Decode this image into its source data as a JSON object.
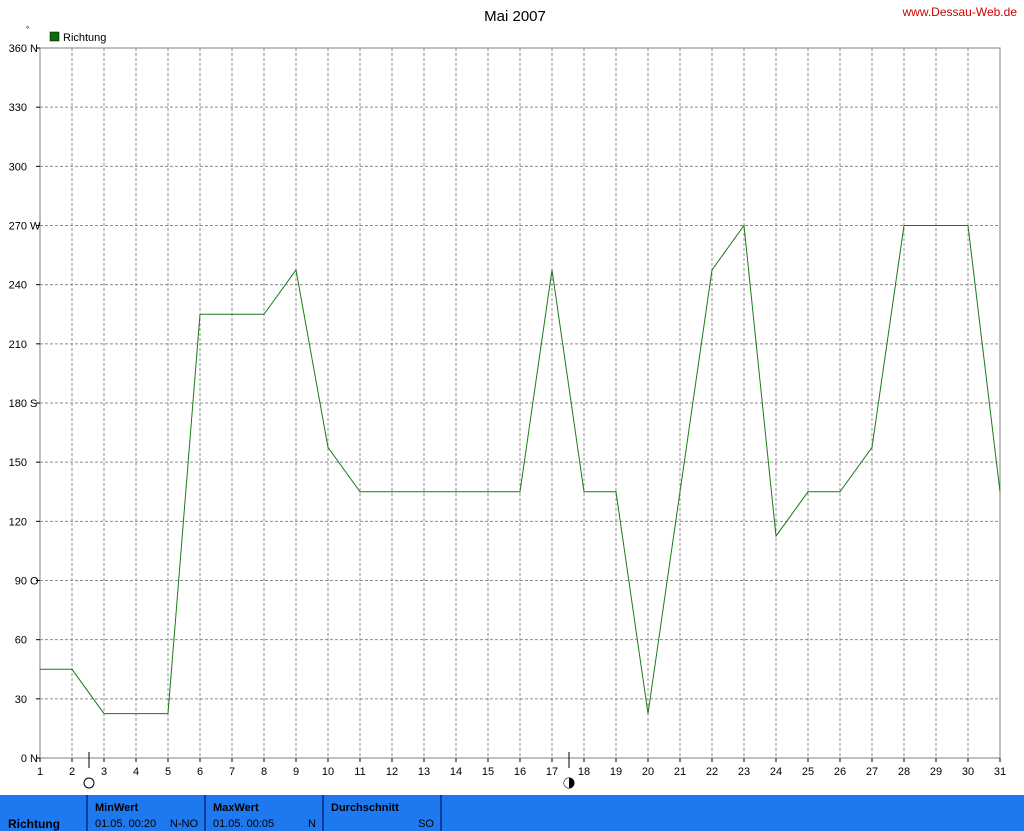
{
  "header": {
    "title": "Mai 2007",
    "url": "www.Dessau-Web.de",
    "unit_mark": "°"
  },
  "colors": {
    "line": "#1a7a1a",
    "legend_swatch": "#0a6e0a",
    "stats_bg": "#1e78f0",
    "grid": "#8c8c8c"
  },
  "icons": {
    "moon_full": "full-moon-icon",
    "moon_new": "new-moon-icon"
  },
  "moon_phases": [
    {
      "day": 2,
      "type": "full-moon"
    },
    {
      "day": 17,
      "type": "new-moon"
    }
  ],
  "chart_data": {
    "type": "line",
    "title": "Mai 2007",
    "legend_position": "top-left",
    "grid": true,
    "xlim": [
      1,
      31
    ],
    "ylim": [
      0,
      360
    ],
    "x_ticks": [
      1,
      2,
      3,
      4,
      5,
      6,
      7,
      8,
      9,
      10,
      11,
      12,
      13,
      14,
      15,
      16,
      17,
      18,
      19,
      20,
      21,
      22,
      23,
      24,
      25,
      26,
      27,
      28,
      29,
      30,
      31
    ],
    "y_ticks": [
      {
        "value": 0,
        "label": "0",
        "dir": "N"
      },
      {
        "value": 30,
        "label": "30",
        "dir": ""
      },
      {
        "value": 60,
        "label": "60",
        "dir": ""
      },
      {
        "value": 90,
        "label": "90",
        "dir": "O"
      },
      {
        "value": 120,
        "label": "120",
        "dir": ""
      },
      {
        "value": 150,
        "label": "150",
        "dir": ""
      },
      {
        "value": 180,
        "label": "180",
        "dir": "S"
      },
      {
        "value": 210,
        "label": "210",
        "dir": ""
      },
      {
        "value": 240,
        "label": "240",
        "dir": ""
      },
      {
        "value": 270,
        "label": "270",
        "dir": "W"
      },
      {
        "value": 300,
        "label": "300",
        "dir": ""
      },
      {
        "value": 330,
        "label": "330",
        "dir": ""
      },
      {
        "value": 360,
        "label": "360",
        "dir": "N"
      }
    ],
    "series": [
      {
        "name": "Richtung",
        "x": [
          1,
          2,
          3,
          4,
          5,
          6,
          7,
          8,
          9,
          10,
          11,
          12,
          13,
          14,
          15,
          16,
          17,
          18,
          19,
          20,
          21,
          22,
          23,
          24,
          25,
          26,
          27,
          28,
          29,
          30,
          31
        ],
        "values": [
          45,
          45,
          22.5,
          22.5,
          22.5,
          225,
          225,
          225,
          247.5,
          157.5,
          135,
          135,
          135,
          135,
          135,
          135,
          247.5,
          135,
          135,
          22.5,
          135,
          247.5,
          270,
          112.5,
          135,
          135,
          157.5,
          270,
          270,
          270,
          135
        ]
      }
    ]
  },
  "stats": {
    "row_label": "Richtung",
    "min": {
      "label": "MinWert",
      "value": "01.05.  00:20",
      "dir": "N-NO"
    },
    "max": {
      "label": "MaxWert",
      "value": "01.05.  00:05",
      "dir": "N"
    },
    "avg": {
      "label": "Durchschnitt",
      "value": "SO"
    }
  }
}
